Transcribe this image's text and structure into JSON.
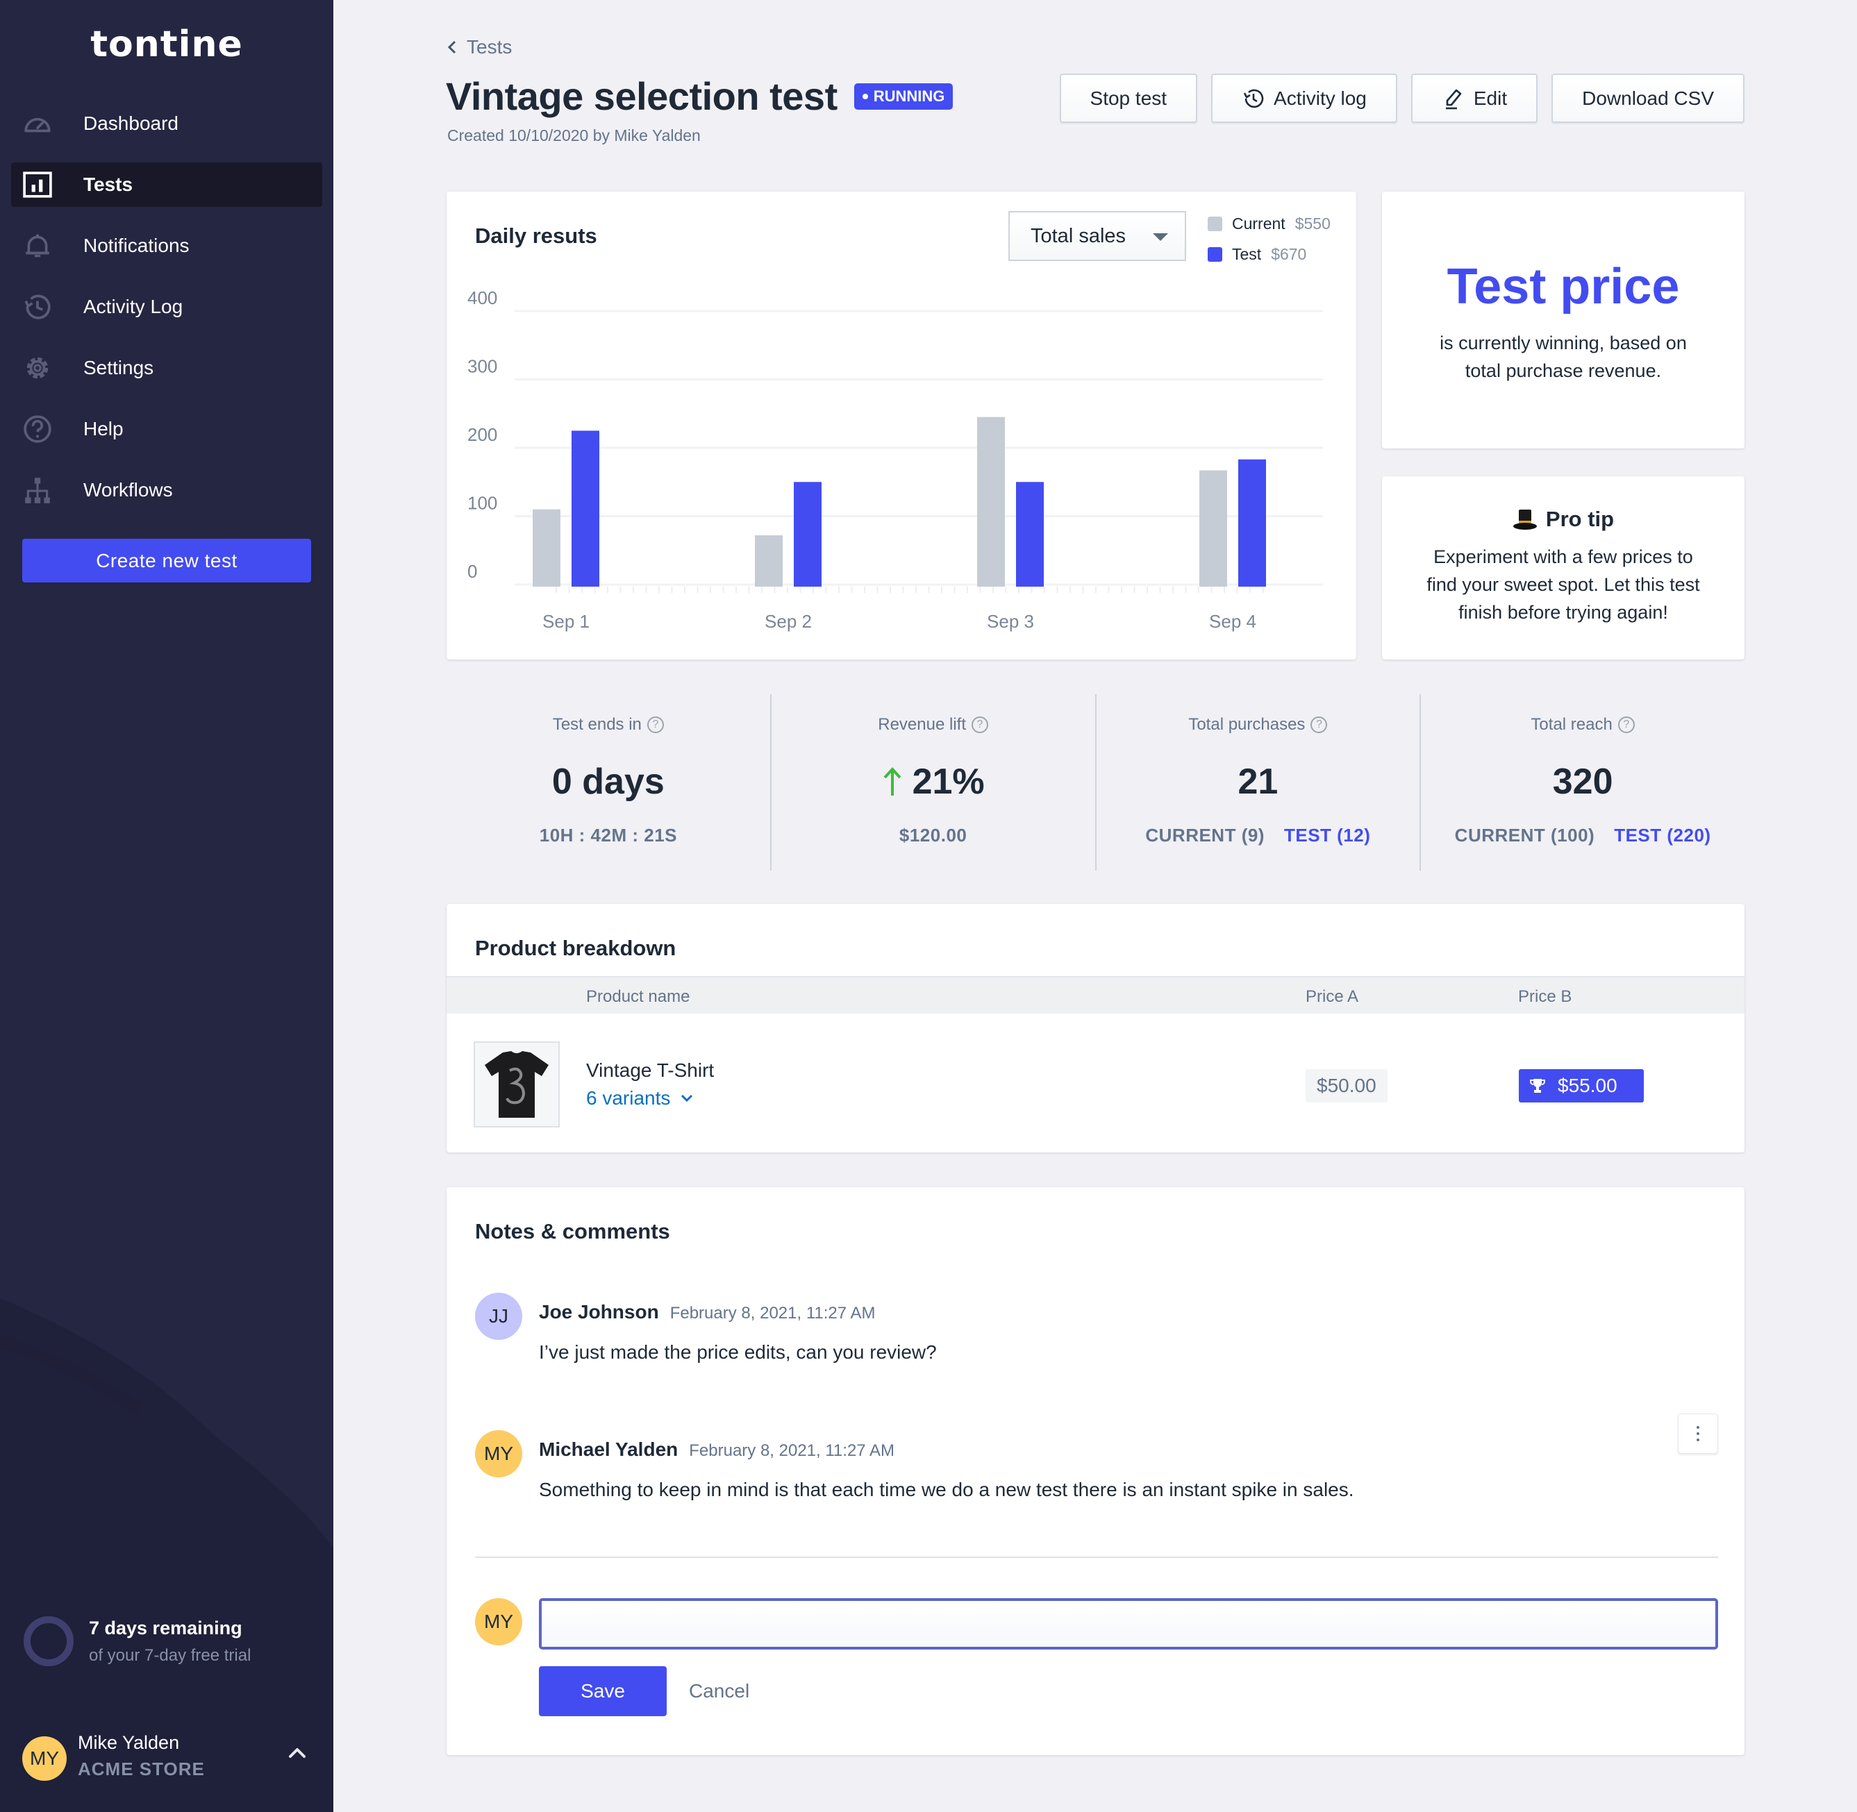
{
  "app": {
    "logo": "tontine"
  },
  "sidebar": {
    "items": [
      {
        "label": "Dashboard",
        "icon": "dashboard-gauge-icon",
        "active": false
      },
      {
        "label": "Tests",
        "icon": "bar-chart-icon",
        "active": true
      },
      {
        "label": "Notifications",
        "icon": "bell-icon",
        "active": false
      },
      {
        "label": "Activity Log",
        "icon": "history-icon",
        "active": false
      },
      {
        "label": "Settings",
        "icon": "gear-icon",
        "active": false
      },
      {
        "label": "Help",
        "icon": "help-circle-icon",
        "active": false
      },
      {
        "label": "Workflows",
        "icon": "sitemap-icon",
        "active": false
      }
    ],
    "create_button": "Create new test",
    "trial": {
      "title": "7 days remaining",
      "subtitle": "of your 7-day free trial",
      "days_remaining": 7,
      "total_days": 7
    },
    "user": {
      "initials": "MY",
      "name": "Mike Yalden",
      "store": "ACME STORE"
    }
  },
  "header": {
    "breadcrumb": "Tests",
    "title": "Vintage selection test",
    "status_badge": "RUNNING",
    "created": "Created 10/10/2020 by Mike Yalden",
    "actions": {
      "stop": "Stop test",
      "activity": "Activity log",
      "edit": "Edit",
      "download": "Download CSV"
    }
  },
  "chart_card": {
    "title": "Daily resuts",
    "metric_select": "Total sales",
    "legend": [
      {
        "name": "Current",
        "value": "$550"
      },
      {
        "name": "Test",
        "value": "$670"
      }
    ]
  },
  "chart_data": {
    "type": "bar",
    "title": "Daily resuts",
    "categories": [
      "Sep 1",
      "Sep 2",
      "Sep 3",
      "Sep 4"
    ],
    "series": [
      {
        "name": "Current",
        "color": "#c5ccd5",
        "values": [
          110,
          72,
          245,
          167
        ]
      },
      {
        "name": "Test",
        "color": "#434cf0",
        "values": [
          225,
          150,
          150,
          183
        ]
      }
    ],
    "yticks": [
      0,
      100,
      200,
      300,
      400
    ],
    "ylim": [
      0,
      400
    ],
    "xlabel": "",
    "ylabel": "",
    "grid": true,
    "legend_position": "top-right"
  },
  "winner": {
    "headline": "Test price",
    "text": "is currently winning, based on total purchase revenue."
  },
  "pro_tip": {
    "title": "Pro tip",
    "icon": "top-hat-icon",
    "text": "Experiment with a few prices to find your sweet spot. Let this test finish before trying again!"
  },
  "stats": [
    {
      "label": "Test ends in",
      "value": "0 days",
      "sub": "10H : 42M : 21S"
    },
    {
      "label": "Revenue lift",
      "value": "21%",
      "trend": "up",
      "sub": "$120.00"
    },
    {
      "label": "Total purchases",
      "value": "21",
      "current": "CURRENT (9)",
      "test": "TEST (12)"
    },
    {
      "label": "Total reach",
      "value": "320",
      "current": "CURRENT (100)",
      "test": "TEST (220)"
    }
  ],
  "product_breakdown": {
    "title": "Product breakdown",
    "columns": [
      "Product name",
      "Price A",
      "Price B"
    ],
    "rows": [
      {
        "name": "Vintage T-Shirt",
        "variants": "6 variants",
        "price_a": "$50.00",
        "price_b": "$55.00",
        "winner": "B"
      }
    ]
  },
  "notes": {
    "title": "Notes & comments",
    "comments": [
      {
        "initials": "JJ",
        "avatar_color": "#c3c5fb",
        "author": "Joe Johnson",
        "time": "February 8, 2021, 11:27 AM",
        "text": "I’ve just made the price edits, can you review?"
      },
      {
        "initials": "MY",
        "avatar_color": "#fccc63",
        "author": "Michael Yalden",
        "time": "February 8, 2021, 11:27 AM",
        "text": "Something to keep in mind is that each time we do a new test there is an instant spike in sales."
      }
    ],
    "composer": {
      "initials": "MY",
      "value": "",
      "placeholder": ""
    },
    "save": "Save",
    "cancel": "Cancel"
  },
  "colors": {
    "accent": "#434cf0",
    "sidebar": "#252641",
    "current": "#c5ccd5",
    "positive": "#3dbb3d"
  }
}
